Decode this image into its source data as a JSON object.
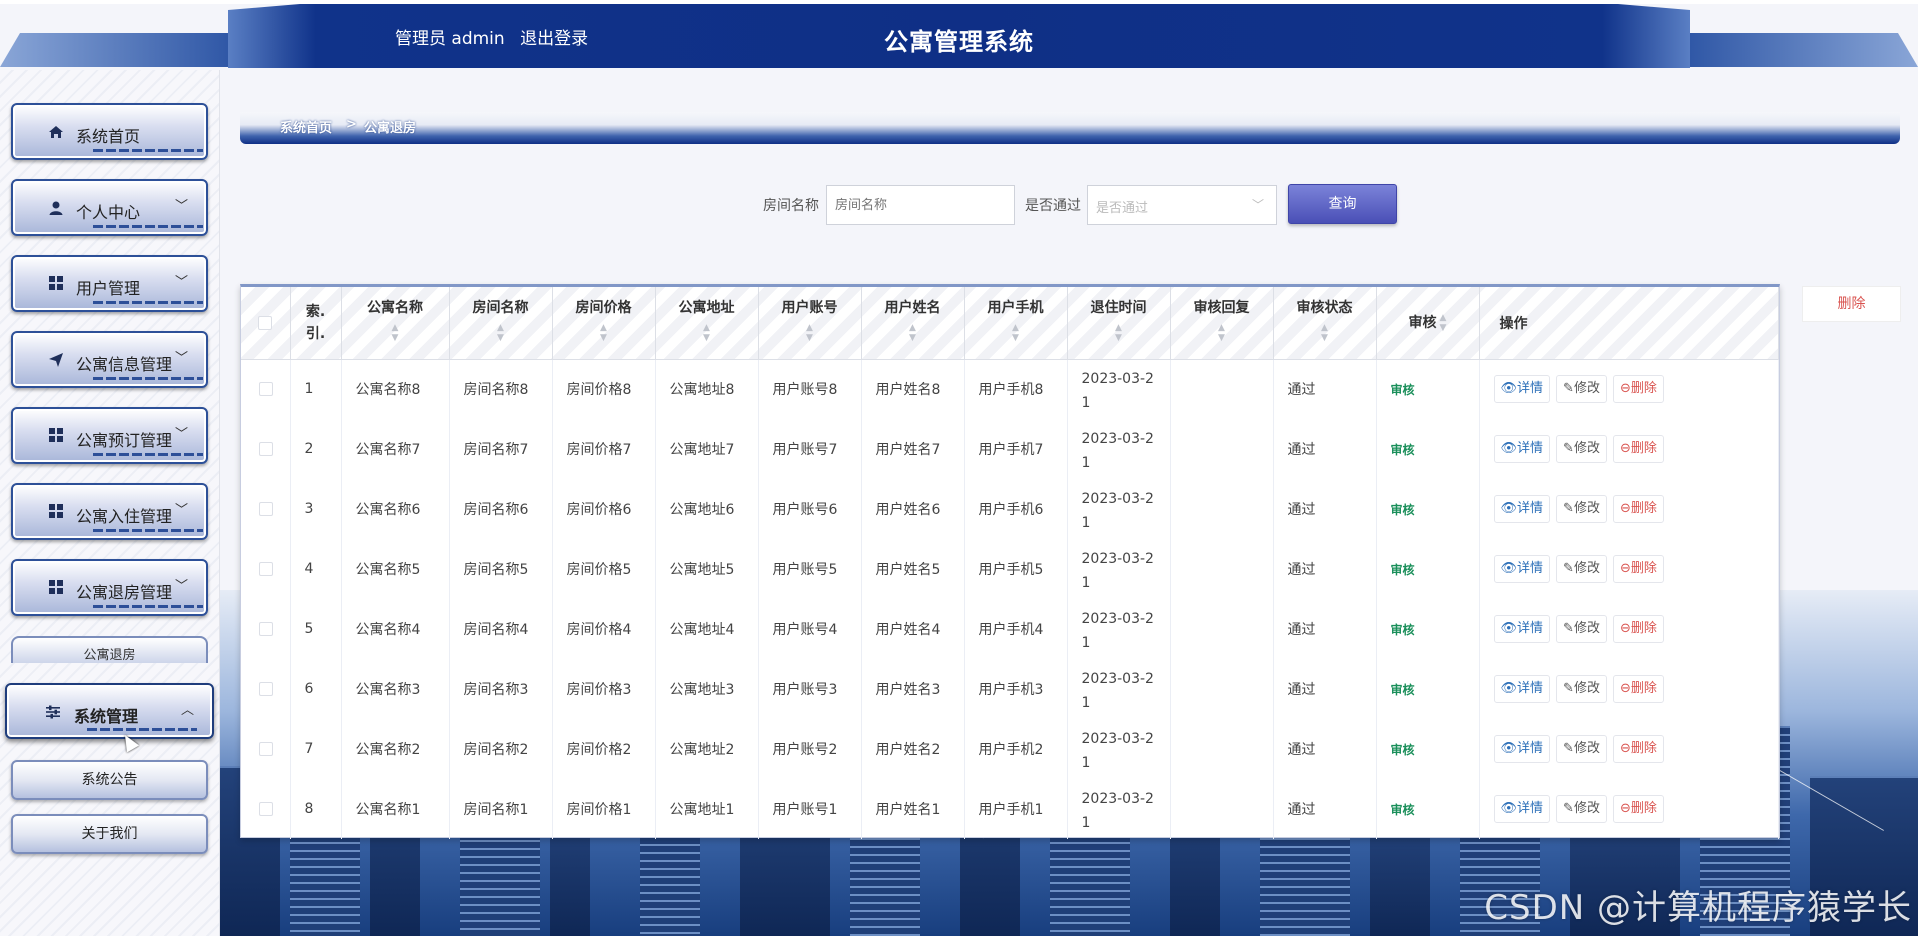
{
  "header": {
    "user_label": "管理员 admin",
    "logout": "退出登录",
    "title": "公寓管理系统"
  },
  "sidebar": {
    "items": [
      {
        "label": "系统首页",
        "icon": "home-icon",
        "arrow": ""
      },
      {
        "label": "个人中心",
        "icon": "user-icon",
        "arrow": "﹀"
      },
      {
        "label": "用户管理",
        "icon": "grid-icon",
        "arrow": "﹀"
      },
      {
        "label": "公寓信息管理",
        "icon": "send-icon",
        "arrow": "﹀"
      },
      {
        "label": "公寓预订管理",
        "icon": "grid-icon",
        "arrow": "﹀"
      },
      {
        "label": "公寓入住管理",
        "icon": "grid-icon",
        "arrow": "﹀"
      },
      {
        "label": "公寓退房管理",
        "icon": "grid-icon",
        "arrow": "﹀"
      }
    ],
    "partial_sub": "公寓退房",
    "active": {
      "label": "系统管理",
      "icon": "sliders-icon",
      "arrow": "︿"
    },
    "sub_items": [
      "系统公告",
      "关于我们"
    ]
  },
  "breadcrumb": {
    "home": "系统首页",
    "sep": ">",
    "current": "公寓退房"
  },
  "search": {
    "room_label": "房间名称",
    "room_placeholder": "房间名称",
    "pass_label": "是否通过",
    "pass_placeholder": "是否通过",
    "query_button": "查询"
  },
  "delete_button": "删除",
  "table": {
    "headers": [
      "索引",
      "公寓名称",
      "房间名称",
      "房间价格",
      "公寓地址",
      "用户账号",
      "用户姓名",
      "用户手机",
      "退住时间",
      "审核回复",
      "审核状态",
      "审核",
      "操作"
    ],
    "index_header_lines": [
      "索.",
      "引."
    ],
    "rows": [
      {
        "idx": "1",
        "apt": "公寓名称8",
        "room": "房间名称8",
        "price": "房间价格8",
        "addr": "公寓地址8",
        "acct": "用户账号8",
        "name": "用户姓名8",
        "phone": "用户手机8",
        "date1": "2023-03-2",
        "date2": "1",
        "reply": "",
        "status": "通过"
      },
      {
        "idx": "2",
        "apt": "公寓名称7",
        "room": "房间名称7",
        "price": "房间价格7",
        "addr": "公寓地址7",
        "acct": "用户账号7",
        "name": "用户姓名7",
        "phone": "用户手机7",
        "date1": "2023-03-2",
        "date2": "1",
        "reply": "",
        "status": "通过"
      },
      {
        "idx": "3",
        "apt": "公寓名称6",
        "room": "房间名称6",
        "price": "房间价格6",
        "addr": "公寓地址6",
        "acct": "用户账号6",
        "name": "用户姓名6",
        "phone": "用户手机6",
        "date1": "2023-03-2",
        "date2": "1",
        "reply": "",
        "status": "通过"
      },
      {
        "idx": "4",
        "apt": "公寓名称5",
        "room": "房间名称5",
        "price": "房间价格5",
        "addr": "公寓地址5",
        "acct": "用户账号5",
        "name": "用户姓名5",
        "phone": "用户手机5",
        "date1": "2023-03-2",
        "date2": "1",
        "reply": "",
        "status": "通过"
      },
      {
        "idx": "5",
        "apt": "公寓名称4",
        "room": "房间名称4",
        "price": "房间价格4",
        "addr": "公寓地址4",
        "acct": "用户账号4",
        "name": "用户姓名4",
        "phone": "用户手机4",
        "date1": "2023-03-2",
        "date2": "1",
        "reply": "",
        "status": "通过"
      },
      {
        "idx": "6",
        "apt": "公寓名称3",
        "room": "房间名称3",
        "price": "房间价格3",
        "addr": "公寓地址3",
        "acct": "用户账号3",
        "name": "用户姓名3",
        "phone": "用户手机3",
        "date1": "2023-03-2",
        "date2": "1",
        "reply": "",
        "status": "通过"
      },
      {
        "idx": "7",
        "apt": "公寓名称2",
        "room": "房间名称2",
        "price": "房间价格2",
        "addr": "公寓地址2",
        "acct": "用户账号2",
        "name": "用户姓名2",
        "phone": "用户手机2",
        "date1": "2023-03-2",
        "date2": "1",
        "reply": "",
        "status": "通过"
      },
      {
        "idx": "8",
        "apt": "公寓名称1",
        "room": "房间名称1",
        "price": "房间价格1",
        "addr": "公寓地址1",
        "acct": "用户账号1",
        "name": "用户姓名1",
        "phone": "用户手机1",
        "date1": "2023-03-2",
        "date2": "1",
        "reply": "",
        "status": "通过"
      }
    ],
    "audit_link": "审核",
    "ops": {
      "view": "详情",
      "edit": "修改",
      "delete": "删除"
    }
  },
  "watermark": "CSDN @计算机程序猿学长",
  "colors": {
    "header_blue": "#0f2f86",
    "audit_green": "#1a8f5a",
    "delete_red": "#d9534f",
    "query_purple": "#4a4fb6"
  }
}
